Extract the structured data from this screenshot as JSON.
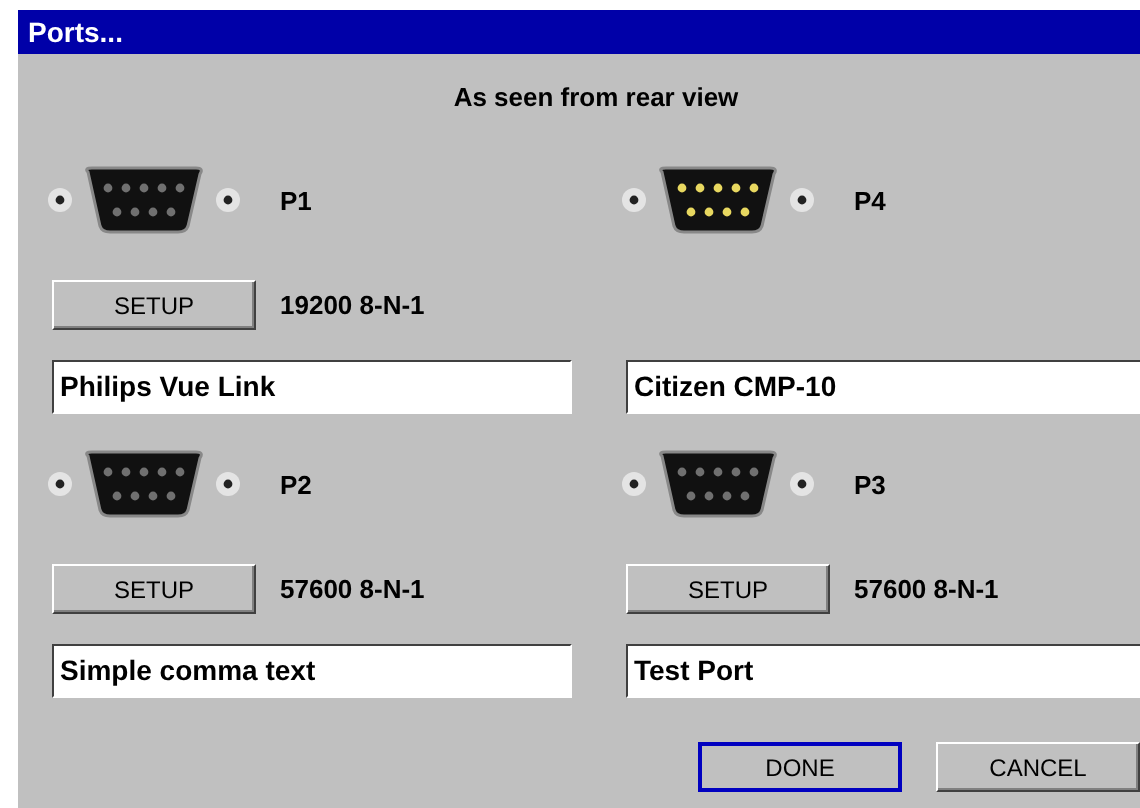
{
  "window": {
    "title": "Ports..."
  },
  "caption": "As seen from rear view",
  "ports": [
    {
      "label": "P1",
      "highlighted": false,
      "setup": {
        "button": "SETUP",
        "settings": "19200 8-N-1"
      },
      "device": "Philips Vue Link"
    },
    {
      "label": "P4",
      "highlighted": true,
      "device": "Citizen CMP-10"
    },
    {
      "label": "P2",
      "highlighted": false,
      "setup": {
        "button": "SETUP",
        "settings": "57600 8-N-1"
      },
      "device": "Simple comma text"
    },
    {
      "label": "P3",
      "highlighted": false,
      "setup": {
        "button": "SETUP",
        "settings": "57600 8-N-1"
      },
      "device": "Test Port"
    }
  ],
  "buttons": [
    {
      "label": "DONE",
      "default": true
    },
    {
      "label": "CANCEL",
      "default": false
    }
  ]
}
